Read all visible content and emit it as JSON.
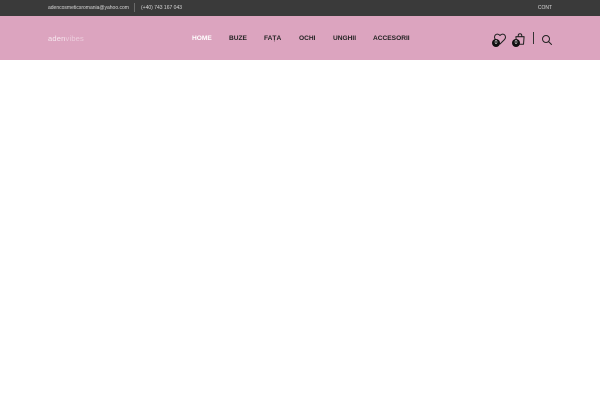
{
  "topbar": {
    "email": "adencosmeticsromania@yahoo.com",
    "phone": "(+40) 743 167 043",
    "account_label": "CONT"
  },
  "logo": {
    "part_a": "aden",
    "part_b": "vibes"
  },
  "nav": {
    "items": [
      {
        "label": "HOME",
        "active": true
      },
      {
        "label": "BUZE"
      },
      {
        "label": "FAȚA"
      },
      {
        "label": "OCHI"
      },
      {
        "label": "UNGHII"
      },
      {
        "label": "ACCESORII"
      }
    ]
  },
  "header_icons": {
    "wishlist": {
      "icon": "heart-icon",
      "count": "0"
    },
    "cart": {
      "icon": "shopping-bag-icon",
      "count": "0"
    },
    "search": {
      "icon": "search-icon"
    }
  },
  "colors": {
    "topbar_bg": "#3a3a3a",
    "header_bg": "#dca4bf",
    "nav_active": "#ffffff",
    "nav_text": "#222222"
  }
}
